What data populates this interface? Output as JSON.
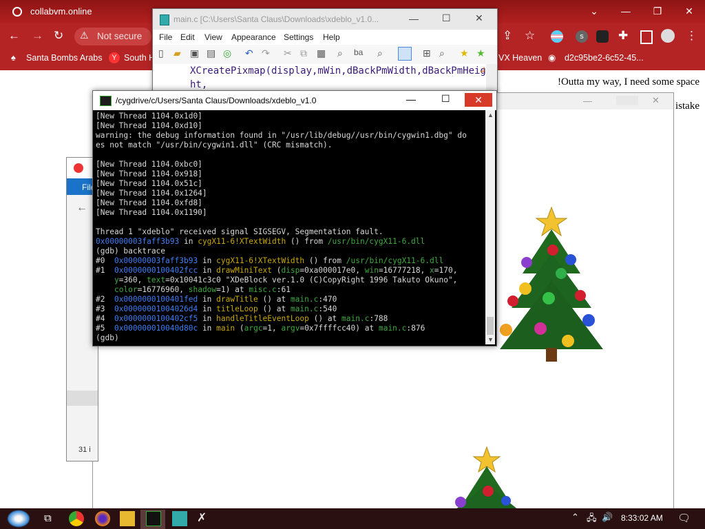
{
  "browser": {
    "tab_title": "collabvm.online",
    "address_status": "Not secure",
    "bookmarks": [
      "Santa Bombs Arabs",
      "South H",
      "VX Heaven",
      "d2c95be2-6c52-45..."
    ]
  },
  "page": {
    "line1": "!Outta my way, I need some space",
    "line2": "istake"
  },
  "editor": {
    "title": "main.c [C:\\Users\\Santa Claus\\Downloads\\xdeblo_v1.0...",
    "menu": [
      "File",
      "Edit",
      "View",
      "Appearance",
      "Settings",
      "Help"
    ],
    "code_line1": "XCreatePixmap(display,mWin,dBackPmWidth,dBackPmHeig",
    "code_line2": "ht,"
  },
  "explorer": {
    "menu_label": "File",
    "status": "31 i"
  },
  "terminal": {
    "title": "/cygdrive/c/Users/Santa Claus/Downloads/xdeblo_v1.0",
    "lines": {
      "l1": "[New Thread 1104.0x1d0]",
      "l2": "[New Thread 1104.0xd10]",
      "l3": "warning: the debug information found in \"/usr/lib/debug//usr/bin/cygwin1.dbg\" do",
      "l4": "es not match \"/usr/bin/cygwin1.dll\" (CRC mismatch).",
      "l5": "",
      "l6": "[New Thread 1104.0xbc0]",
      "l7": "[New Thread 1104.0x918]",
      "l8": "[New Thread 1104.0x51c]",
      "l9": "[New Thread 1104.0x1264]",
      "l10": "[New Thread 1104.0xfd8]",
      "l11": "[New Thread 1104.0x1190]",
      "l12": "",
      "l13": "Thread 1 \"xdeblo\" received signal SIGSEGV, Segmentation fault.",
      "l14a": "0x00000003faff3b93",
      "l14b": " in ",
      "l14c": "cygX11-6!XTextWidth",
      "l14d": " () from ",
      "l14e": "/usr/bin/cygX11-6.dll",
      "l15": "(gdb) backtrace",
      "f0a": "#0  ",
      "f0b": "0x00000003faff3b93",
      "f0c": " in ",
      "f0d": "cygX11-6!XTextWidth",
      "f0e": " () from ",
      "f0f": "/usr/bin/cygX11-6.dll",
      "f1a": "#1  ",
      "f1b": "0x0000000100402fcc",
      "f1c": " in ",
      "f1d": "drawMiniText",
      "f1e": " (",
      "f1f": "disp",
      "f1g": "=0xa000017e0, ",
      "f1h": "win",
      "f1i": "=16777218, ",
      "f1j": "x",
      "f1k": "=170,",
      "f1l": "    ",
      "f1m": "y",
      "f1n": "=360, ",
      "f1o": "text",
      "f1p": "=0x10041c3c0 \"XDeBlock ver.1.0 (C)CopyRight 1996 Takuto Okuno\",",
      "f1q": "    ",
      "f1r": "color",
      "f1s": "=16776960, ",
      "f1t": "shadow",
      "f1u": "=1) at ",
      "f1v": "misc.c",
      "f1w": ":61",
      "f2a": "#2  ",
      "f2b": "0x0000000100401fed",
      "f2c": " in ",
      "f2d": "drawTitle",
      "f2e": " () at ",
      "f2f": "main.c",
      "f2g": ":470",
      "f3a": "#3  ",
      "f3b": "0x00000001004026d4",
      "f3c": " in ",
      "f3d": "titleLoop",
      "f3e": " () at ",
      "f3f": "main.c",
      "f3g": ":540",
      "f4a": "#4  ",
      "f4b": "0x0000000100402cf5",
      "f4c": " in ",
      "f4d": "handleTitleEventLoop",
      "f4e": " () at ",
      "f4f": "main.c",
      "f4g": ":788",
      "f5a": "#5  ",
      "f5b": "0x000000010040d80c",
      "f5c": " in ",
      "f5d": "main",
      "f5e": " (",
      "f5f": "argc",
      "f5g": "=1, ",
      "f5h": "argv",
      "f5i": "=0x7ffffcc40) at ",
      "f5j": "main.c",
      "f5k": ":876",
      "prompt": "(gdb)"
    }
  },
  "taskbar": {
    "clock": "8:33:02 AM"
  },
  "colors": {
    "chrome_red": "#b52424",
    "terminal_bg": "#000000",
    "gdb_address_blue": "#3e7ef6",
    "gdb_function_yellow": "#c8a800",
    "gdb_file_green": "#3ea93e"
  }
}
